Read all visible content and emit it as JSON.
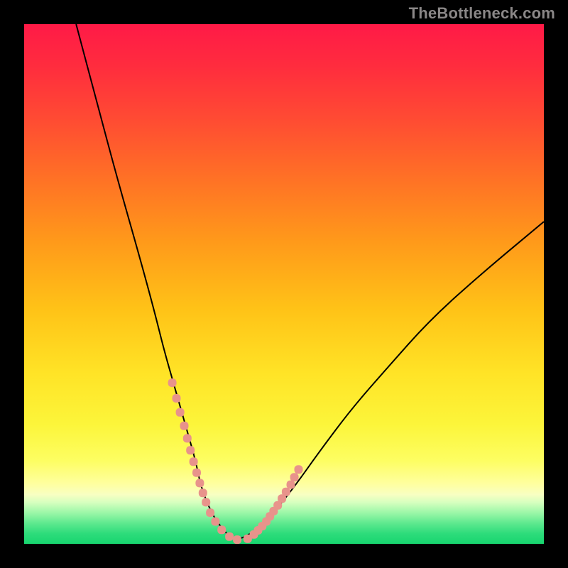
{
  "watermark": "TheBottleneck.com",
  "colors": {
    "page_bg": "#000000",
    "curve": "#000000",
    "dots": "#e8938b",
    "gradient_stops": [
      {
        "pct": 0,
        "hex": "#ff1a47"
      },
      {
        "pct": 8,
        "hex": "#ff2c3e"
      },
      {
        "pct": 18,
        "hex": "#ff4a33"
      },
      {
        "pct": 30,
        "hex": "#ff7225"
      },
      {
        "pct": 42,
        "hex": "#ff9a1a"
      },
      {
        "pct": 55,
        "hex": "#ffc317"
      },
      {
        "pct": 67,
        "hex": "#ffe326"
      },
      {
        "pct": 77,
        "hex": "#fcf53a"
      },
      {
        "pct": 84,
        "hex": "#fdfe62"
      },
      {
        "pct": 88.5,
        "hex": "#ffffa0"
      },
      {
        "pct": 90.5,
        "hex": "#f8ffc2"
      },
      {
        "pct": 92,
        "hex": "#d7ffbf"
      },
      {
        "pct": 94,
        "hex": "#9cf7a8"
      },
      {
        "pct": 96,
        "hex": "#5fe98f"
      },
      {
        "pct": 98,
        "hex": "#2edc7b"
      },
      {
        "pct": 100,
        "hex": "#17d56f"
      }
    ]
  },
  "chart_data": {
    "type": "line",
    "title": "",
    "xlabel": "",
    "ylabel": "",
    "x_range": [
      0,
      100
    ],
    "y_range": [
      0,
      100
    ],
    "series": [
      {
        "name": "bottleneck_curve",
        "x": [
          10,
          14,
          18,
          22,
          25,
          27,
          29,
          31,
          33,
          34,
          36,
          38,
          40,
          42,
          45,
          48,
          52,
          57,
          63,
          70,
          78,
          88,
          100
        ],
        "y": [
          100,
          85,
          70,
          56,
          45,
          37,
          30,
          23,
          16,
          11,
          6,
          3,
          1,
          1,
          3,
          6,
          11,
          18,
          26,
          34,
          43,
          52,
          62
        ]
      }
    ],
    "highlighted_points": {
      "name": "dot_cluster",
      "x": [
        28.5,
        29.3,
        30.0,
        30.8,
        31.4,
        32.0,
        32.6,
        33.2,
        33.8,
        34.4,
        35.0,
        35.8,
        36.8,
        38.0,
        39.5,
        41.0,
        43.0,
        44.2,
        45.0,
        45.8,
        46.6,
        47.3,
        48.0,
        48.8,
        49.6,
        50.4,
        51.3,
        52.0,
        52.8
      ],
      "y": [
        31.0,
        28.0,
        25.3,
        22.7,
        20.3,
        18.0,
        15.8,
        13.7,
        11.7,
        9.8,
        8.0,
        6.0,
        4.3,
        2.7,
        1.4,
        0.8,
        1.0,
        1.8,
        2.6,
        3.4,
        4.3,
        5.3,
        6.3,
        7.4,
        8.7,
        10.0,
        11.4,
        12.8,
        14.3
      ]
    }
  }
}
